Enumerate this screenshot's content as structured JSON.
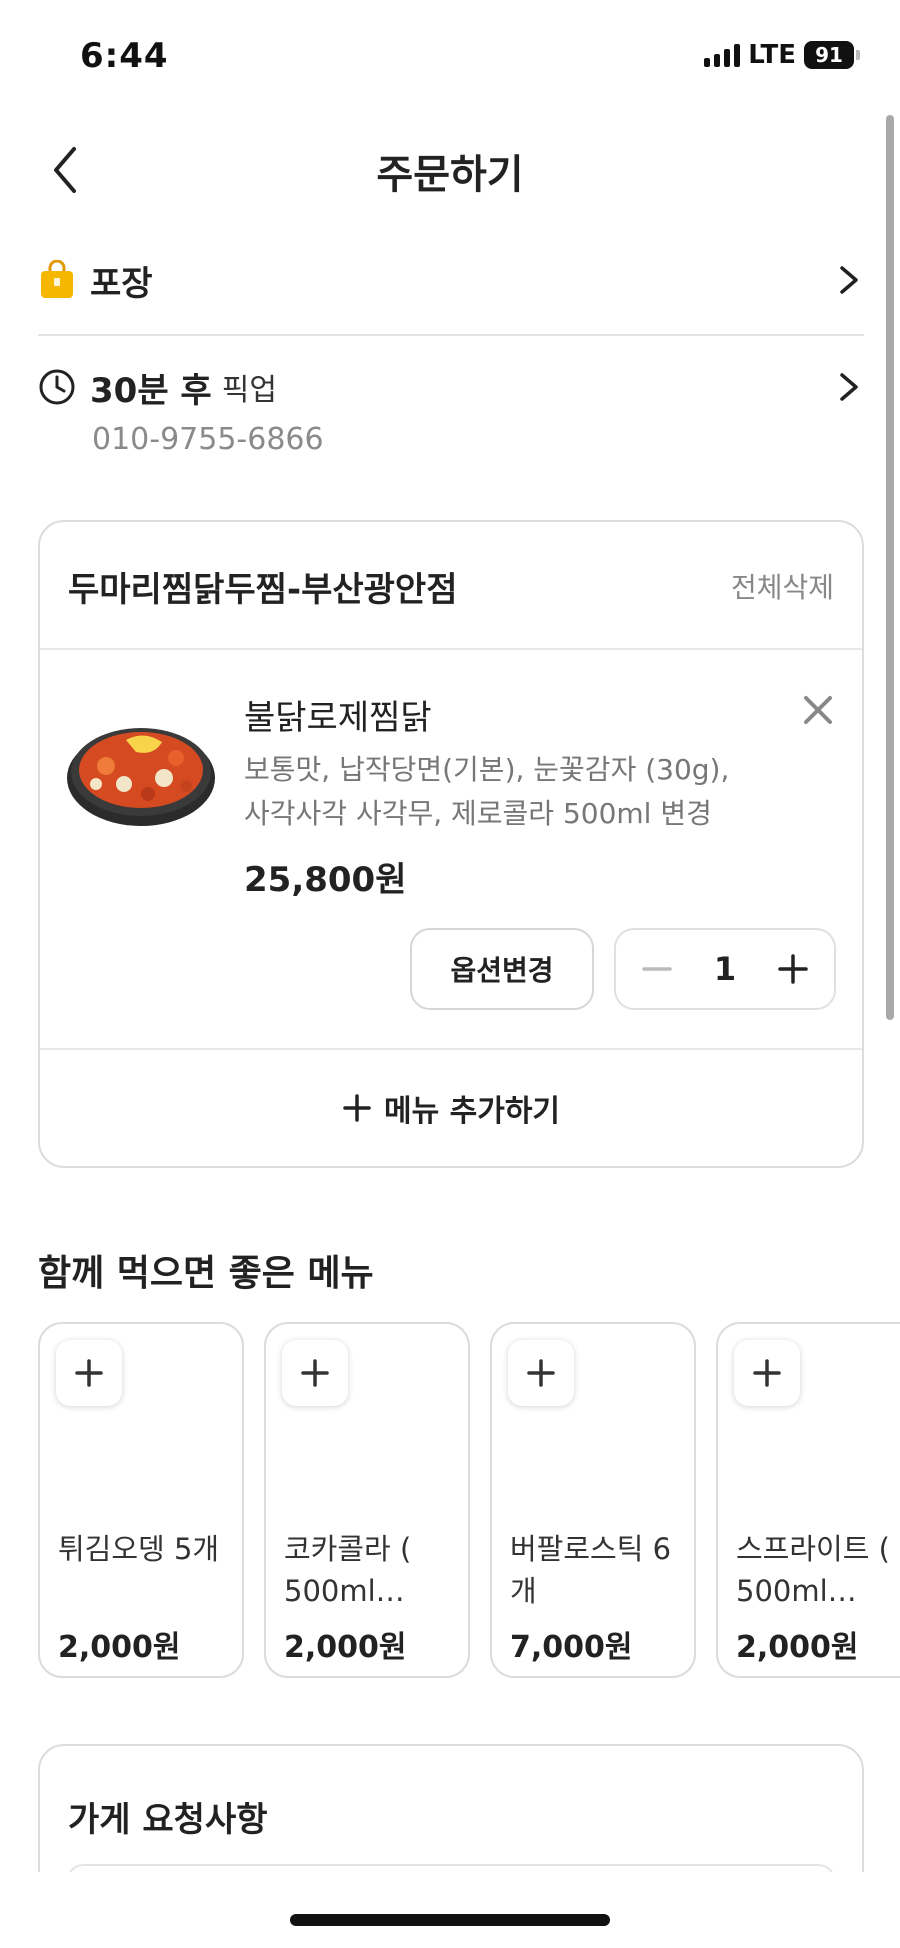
{
  "status_bar": {
    "time": "6:44",
    "network": "LTE",
    "battery": "91"
  },
  "header": {
    "title": "주문하기",
    "back_icon": "chevron-left-icon"
  },
  "order_type": {
    "label": "포장",
    "icon": "shopping-bag-icon",
    "icon_color": "#F5B700"
  },
  "pickup": {
    "time_label": "30분 후",
    "suffix": "픽업",
    "phone": "010-9755-6866",
    "icon": "clock-icon"
  },
  "cart": {
    "store_name": "두마리찜닭두찜-부산광안점",
    "delete_all": "전체삭제",
    "item": {
      "name": "불닭로제찜닭",
      "options_line1": "보통맛, 납작당면(기본), 눈꽃감자 (30g),",
      "options_line2": "사각사각 사각무, 제로콜라 500ml 변경",
      "price": "25,800원",
      "change_option": "옵션변경",
      "quantity": "1"
    },
    "add_menu": "메뉴 추가하기"
  },
  "recommend": {
    "title": "함께 먹으면 좋은 메뉴",
    "items": [
      {
        "name": "튀김오뎅 5개",
        "price": "2,000원"
      },
      {
        "name": "코카콜라 ( 500ml…",
        "price": "2,000원"
      },
      {
        "name": "버팔로스틱 6개",
        "price": "7,000원"
      },
      {
        "name": "스프라이트 ( 500ml…",
        "price": "2,000원"
      }
    ]
  },
  "request": {
    "title": "가게 요청사항"
  }
}
